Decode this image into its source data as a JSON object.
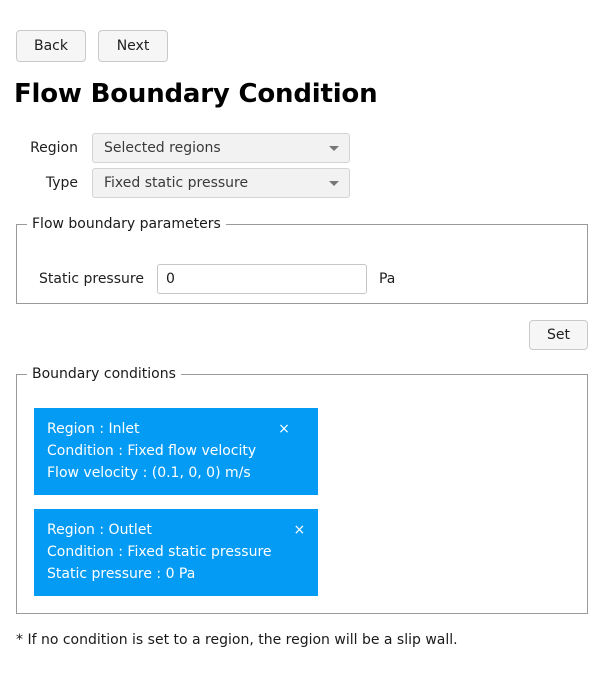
{
  "nav": {
    "back_label": "Back",
    "next_label": "Next"
  },
  "page_title": "Flow Boundary Condition",
  "selectors": [
    {
      "label": "Region",
      "value": "Selected regions",
      "icon": "chevron-down-icon"
    },
    {
      "label": "Type",
      "value": "Fixed static pressure",
      "icon": "chevron-down-icon"
    }
  ],
  "parameters": {
    "legend": "Flow boundary parameters",
    "field_label": "Static pressure",
    "field_value": "0",
    "field_placeholder": "",
    "unit": "Pa"
  },
  "actions": {
    "set_label": "Set"
  },
  "conditions": {
    "legend": "Boundary conditions",
    "close_glyph": "×",
    "accent_color": "#039BF4",
    "cards": [
      {
        "line1": "Region : Inlet",
        "line2": "Condition : Fixed flow velocity",
        "line3": "Flow velocity : (0.1, 0, 0) m/s"
      },
      {
        "line1": "Region : Outlet",
        "line2": "Condition : Fixed static pressure",
        "line3": "Static pressure : 0 Pa"
      }
    ]
  },
  "footnote": "* If no condition is set to a region, the region will be a slip wall."
}
